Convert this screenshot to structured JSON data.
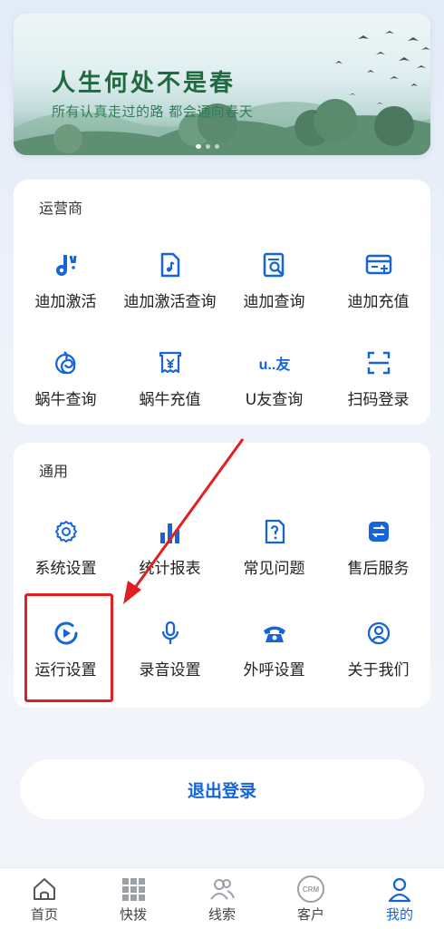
{
  "banner": {
    "title": "人生何处不是春",
    "subtitle": "所有认真走过的路 都会通向春天"
  },
  "operators": {
    "title": "运营商",
    "items": [
      {
        "label": "迪加激活",
        "icon": "music-note-icon"
      },
      {
        "label": "迪加激活查询",
        "icon": "file-music-icon"
      },
      {
        "label": "迪加查询",
        "icon": "document-search-icon"
      },
      {
        "label": "迪加充值",
        "icon": "card-plus-icon"
      },
      {
        "label": "蜗牛查询",
        "icon": "snail-spiral-icon"
      },
      {
        "label": "蜗牛充值",
        "icon": "yuan-ticket-icon"
      },
      {
        "label": "U友查询",
        "icon": "u-you-logo-icon",
        "icon_text": "u..友"
      },
      {
        "label": "扫码登录",
        "icon": "scan-frame-icon"
      }
    ]
  },
  "general": {
    "title": "通用",
    "items": [
      {
        "label": "系统设置",
        "icon": "gear-icon"
      },
      {
        "label": "统计报表",
        "icon": "bar-chart-icon"
      },
      {
        "label": "常见问题",
        "icon": "question-icon"
      },
      {
        "label": "售后服务",
        "icon": "service-icon"
      },
      {
        "label": "运行设置",
        "icon": "play-circle-icon"
      },
      {
        "label": "录音设置",
        "icon": "microphone-icon"
      },
      {
        "label": "外呼设置",
        "icon": "telephone-icon"
      },
      {
        "label": "关于我们",
        "icon": "person-circle-icon"
      }
    ]
  },
  "logout": {
    "label": "退出登录"
  },
  "tabbar": {
    "items": [
      {
        "label": "首页",
        "icon": "home-icon"
      },
      {
        "label": "快拨",
        "icon": "dialpad-icon"
      },
      {
        "label": "线索",
        "icon": "people-icon"
      },
      {
        "label": "客户",
        "icon": "crm-icon",
        "icon_text": "CRM"
      },
      {
        "label": "我的",
        "icon": "user-icon",
        "active": true
      }
    ]
  },
  "colors": {
    "accent": "#1565d8",
    "annotation": "#e02020"
  }
}
